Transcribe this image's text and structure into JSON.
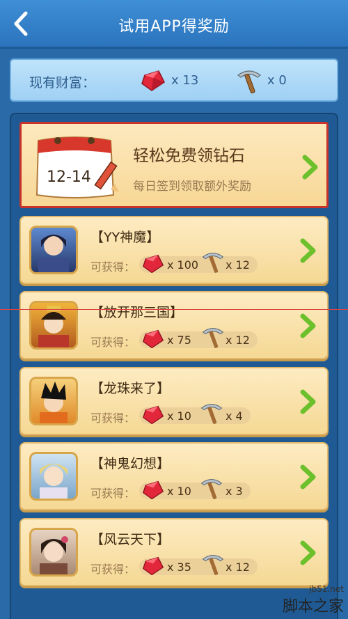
{
  "header": {
    "title": "试用APP得奖励",
    "back_icon": "chevron-left-icon"
  },
  "wealth": {
    "label": "现有财富：",
    "gems": "x 13",
    "picks": "x 0"
  },
  "signin": {
    "date": "12-14",
    "title": "轻松免费领钻石",
    "subtitle": "每日签到领取额外奖励"
  },
  "games": [
    {
      "name": "【YY神魔】",
      "label": "可获得：",
      "gems": "x 100",
      "picks": "x 12"
    },
    {
      "name": "【放开那三国】",
      "label": "可获得：",
      "gems": "x 75",
      "picks": "x 12"
    },
    {
      "name": "【龙珠来了】",
      "label": "可获得：",
      "gems": "x 10",
      "picks": "x 4"
    },
    {
      "name": "【神鬼幻想】",
      "label": "可获得：",
      "gems": "x 10",
      "picks": "x 3"
    },
    {
      "name": "【风云天下】",
      "label": "可获得：",
      "gems": "x 35",
      "picks": "x 12"
    }
  ],
  "watermark": {
    "small": "jb51.net",
    "big": "脚本之家"
  },
  "colors": {
    "accent_red": "#c9332a",
    "chevron_green": "#6cc02c",
    "header_blue": "#3f8fd6"
  }
}
